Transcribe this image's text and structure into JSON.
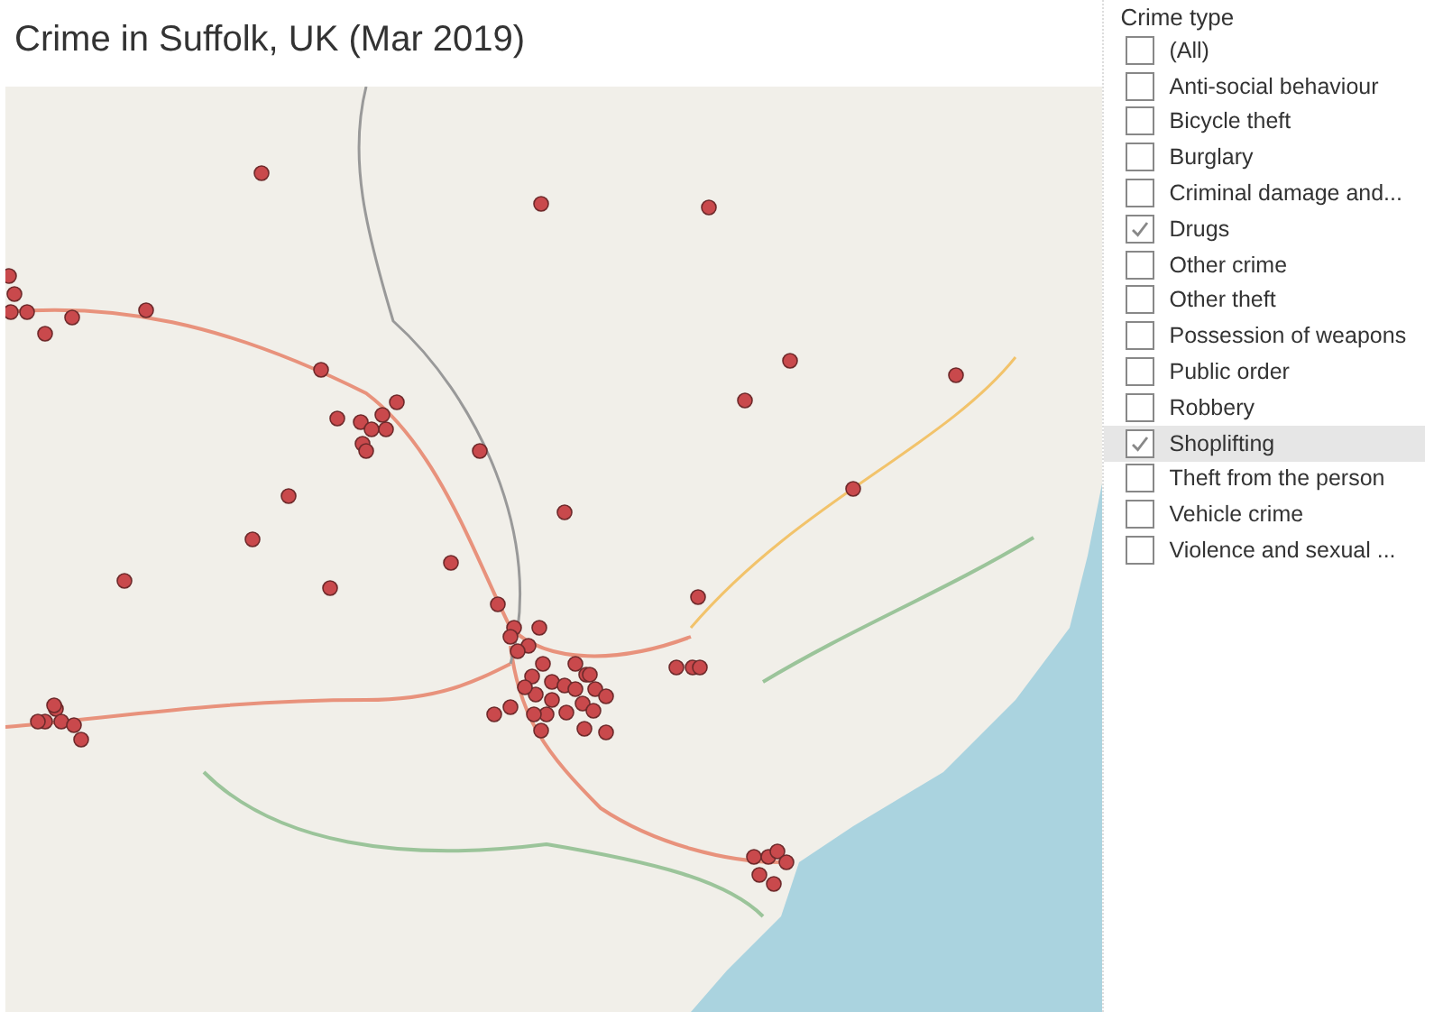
{
  "title": "Crime in Suffolk, UK (Mar 2019)",
  "filter": {
    "title": "Crime type",
    "items": [
      {
        "label": "(All)",
        "checked": false,
        "hovered": false
      },
      {
        "label": "Anti-social behaviour",
        "checked": false,
        "hovered": false
      },
      {
        "label": "Bicycle theft",
        "checked": false,
        "hovered": false
      },
      {
        "label": "Burglary",
        "checked": false,
        "hovered": false
      },
      {
        "label": "Criminal damage and...",
        "checked": false,
        "hovered": false
      },
      {
        "label": "Drugs",
        "checked": true,
        "hovered": false
      },
      {
        "label": "Other crime",
        "checked": false,
        "hovered": false
      },
      {
        "label": "Other theft",
        "checked": false,
        "hovered": false
      },
      {
        "label": "Possession of weapons",
        "checked": false,
        "hovered": false
      },
      {
        "label": "Public order",
        "checked": false,
        "hovered": false
      },
      {
        "label": "Robbery",
        "checked": false,
        "hovered": false
      },
      {
        "label": "Shoplifting",
        "checked": true,
        "hovered": true
      },
      {
        "label": "Theft from the person",
        "checked": false,
        "hovered": false
      },
      {
        "label": "Vehicle crime",
        "checked": false,
        "hovered": false
      },
      {
        "label": "Violence and sexual ...",
        "checked": false,
        "hovered": false
      }
    ]
  }
}
